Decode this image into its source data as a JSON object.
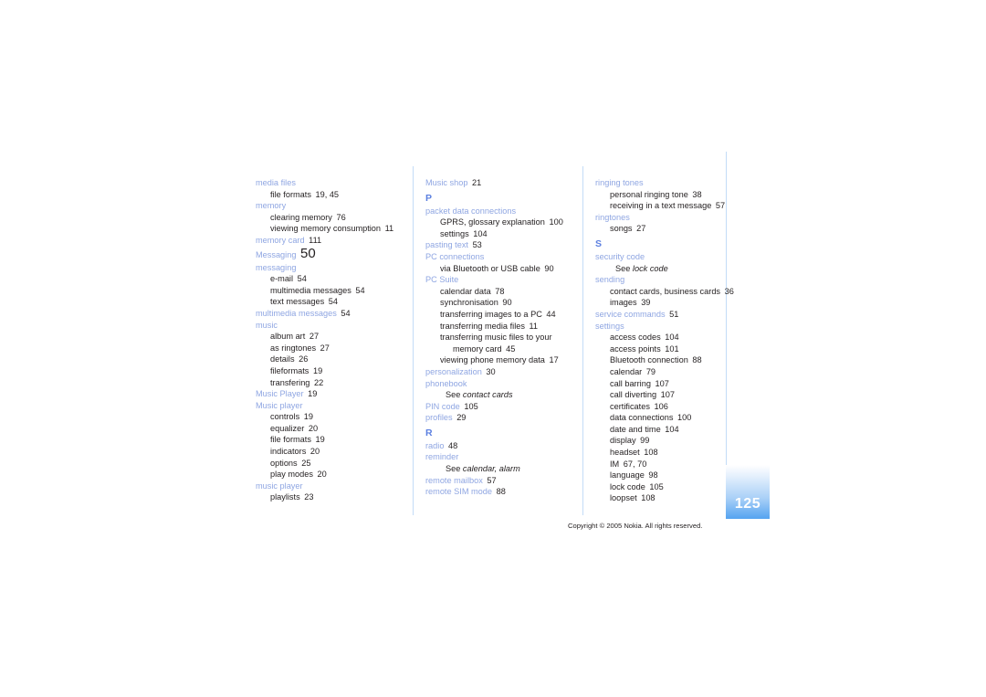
{
  "document": {
    "type": "index-page",
    "page_number": "125",
    "copyright": "Copyright © 2005 Nokia. All rights reserved."
  },
  "colors": {
    "entry_blue": "#8fa6e2",
    "letter_blue": "#5b7fe0",
    "body_black": "#231f20",
    "rule_blue": "#c3dcf7",
    "page_box_blue": "#55a3f0"
  },
  "columns": [
    {
      "id": "column-1",
      "entries": [
        {
          "kind": "level1",
          "text": "media files",
          "page": ""
        },
        {
          "kind": "level2",
          "text": "file formats",
          "page": "19, 45"
        },
        {
          "kind": "level1",
          "text": "memory",
          "page": ""
        },
        {
          "kind": "level2",
          "text": "clearing memory",
          "page": "76"
        },
        {
          "kind": "level2",
          "text": "viewing memory consumption",
          "page": "11"
        },
        {
          "kind": "level1",
          "text": "memory card",
          "page": "111"
        },
        {
          "kind": "level1-big",
          "text": "Messaging",
          "page": "50"
        },
        {
          "kind": "level1",
          "text": "messaging",
          "page": ""
        },
        {
          "kind": "level2",
          "text": "e-mail",
          "page": "54"
        },
        {
          "kind": "level2",
          "text": "multimedia messages",
          "page": "54"
        },
        {
          "kind": "level2",
          "text": "text messages",
          "page": "54"
        },
        {
          "kind": "level1",
          "text": "multimedia messages",
          "page": "54"
        },
        {
          "kind": "level1",
          "text": "music",
          "page": ""
        },
        {
          "kind": "level2",
          "text": "album art",
          "page": "27"
        },
        {
          "kind": "level2",
          "text": "as ringtones",
          "page": "27"
        },
        {
          "kind": "level2",
          "text": "details",
          "page": "26"
        },
        {
          "kind": "level2",
          "text": "fileformats",
          "page": "19"
        },
        {
          "kind": "level2",
          "text": "transfering",
          "page": "22"
        },
        {
          "kind": "level1",
          "text": "Music Player",
          "page": "19"
        },
        {
          "kind": "level1",
          "text": "Music player",
          "page": ""
        },
        {
          "kind": "level2",
          "text": "controls",
          "page": "19"
        },
        {
          "kind": "level2",
          "text": "equalizer",
          "page": "20"
        },
        {
          "kind": "level2",
          "text": "file formats",
          "page": "19"
        },
        {
          "kind": "level2",
          "text": "indicators",
          "page": "20"
        },
        {
          "kind": "level2",
          "text": "options",
          "page": "25"
        },
        {
          "kind": "level2",
          "text": "play modes",
          "page": "20"
        },
        {
          "kind": "level1",
          "text": "music player",
          "page": ""
        },
        {
          "kind": "level2",
          "text": "playlists",
          "page": "23"
        }
      ]
    },
    {
      "id": "column-2",
      "entries": [
        {
          "kind": "level1",
          "text": "Music shop",
          "page": "21"
        },
        {
          "kind": "letter",
          "text": "P",
          "page": ""
        },
        {
          "kind": "level1",
          "text": "packet data connections",
          "page": ""
        },
        {
          "kind": "level2",
          "text": "GPRS, glossary explanation",
          "page": "100"
        },
        {
          "kind": "level2",
          "text": "settings",
          "page": "104"
        },
        {
          "kind": "level1",
          "text": "pasting text",
          "page": "53"
        },
        {
          "kind": "level1",
          "text": "PC connections",
          "page": ""
        },
        {
          "kind": "level2",
          "text": "via Bluetooth or USB cable",
          "page": "90"
        },
        {
          "kind": "level1",
          "text": "PC Suite",
          "page": ""
        },
        {
          "kind": "level2",
          "text": "calendar data",
          "page": "78"
        },
        {
          "kind": "level2",
          "text": "synchronisation",
          "page": "90"
        },
        {
          "kind": "level2",
          "text": "transferring images to a PC",
          "page": "44"
        },
        {
          "kind": "level2",
          "text": "transferring media files",
          "page": "11"
        },
        {
          "kind": "level2",
          "text": "transferring music files to your",
          "page": ""
        },
        {
          "kind": "level3",
          "text": "memory card",
          "page": "45"
        },
        {
          "kind": "level2",
          "text": "viewing phone memory data",
          "page": "17"
        },
        {
          "kind": "level1",
          "text": "personalization",
          "page": "30"
        },
        {
          "kind": "level1",
          "text": "phonebook",
          "page": ""
        },
        {
          "kind": "see",
          "see_label": "See",
          "see_target": "contact cards"
        },
        {
          "kind": "level1",
          "text": "PIN code",
          "page": "105"
        },
        {
          "kind": "level1",
          "text": "profiles",
          "page": "29"
        },
        {
          "kind": "letter",
          "text": "R",
          "page": ""
        },
        {
          "kind": "level1",
          "text": "radio",
          "page": "48"
        },
        {
          "kind": "level1",
          "text": "reminder",
          "page": ""
        },
        {
          "kind": "see",
          "see_label": "See",
          "see_target": "calendar, alarm"
        },
        {
          "kind": "level1",
          "text": "remote mailbox",
          "page": "57"
        },
        {
          "kind": "level1",
          "text": "remote SIM mode",
          "page": "88"
        }
      ]
    },
    {
      "id": "column-3",
      "entries": [
        {
          "kind": "level1",
          "text": "ringing tones",
          "page": ""
        },
        {
          "kind": "level2",
          "text": "personal ringing tone",
          "page": "38"
        },
        {
          "kind": "level2",
          "text": "receiving in a text message",
          "page": "57"
        },
        {
          "kind": "level1",
          "text": "ringtones",
          "page": ""
        },
        {
          "kind": "level2",
          "text": "songs",
          "page": "27"
        },
        {
          "kind": "letter",
          "text": "S",
          "page": ""
        },
        {
          "kind": "level1",
          "text": "security code",
          "page": ""
        },
        {
          "kind": "see",
          "see_label": "See",
          "see_target": "lock code"
        },
        {
          "kind": "level1",
          "text": "sending",
          "page": ""
        },
        {
          "kind": "level2",
          "text": "contact cards, business cards",
          "page": "36"
        },
        {
          "kind": "level2",
          "text": "images",
          "page": "39"
        },
        {
          "kind": "level1",
          "text": "service commands",
          "page": "51"
        },
        {
          "kind": "level1",
          "text": "settings",
          "page": ""
        },
        {
          "kind": "level2",
          "text": "access codes",
          "page": "104"
        },
        {
          "kind": "level2",
          "text": "access points",
          "page": "101"
        },
        {
          "kind": "level2",
          "text": "Bluetooth connection",
          "page": "88"
        },
        {
          "kind": "level2",
          "text": "calendar",
          "page": "79"
        },
        {
          "kind": "level2",
          "text": "call barring",
          "page": "107"
        },
        {
          "kind": "level2",
          "text": "call diverting",
          "page": "107"
        },
        {
          "kind": "level2",
          "text": "certificates",
          "page": "106"
        },
        {
          "kind": "level2",
          "text": "data connections",
          "page": "100"
        },
        {
          "kind": "level2",
          "text": "date and time",
          "page": "104"
        },
        {
          "kind": "level2",
          "text": "display",
          "page": "99"
        },
        {
          "kind": "level2",
          "text": "headset",
          "page": "108"
        },
        {
          "kind": "level2",
          "text": "IM",
          "page": "67, 70"
        },
        {
          "kind": "level2",
          "text": "language",
          "page": "98"
        },
        {
          "kind": "level2",
          "text": "lock code",
          "page": "105"
        },
        {
          "kind": "level2",
          "text": "loopset",
          "page": "108"
        }
      ]
    }
  ]
}
